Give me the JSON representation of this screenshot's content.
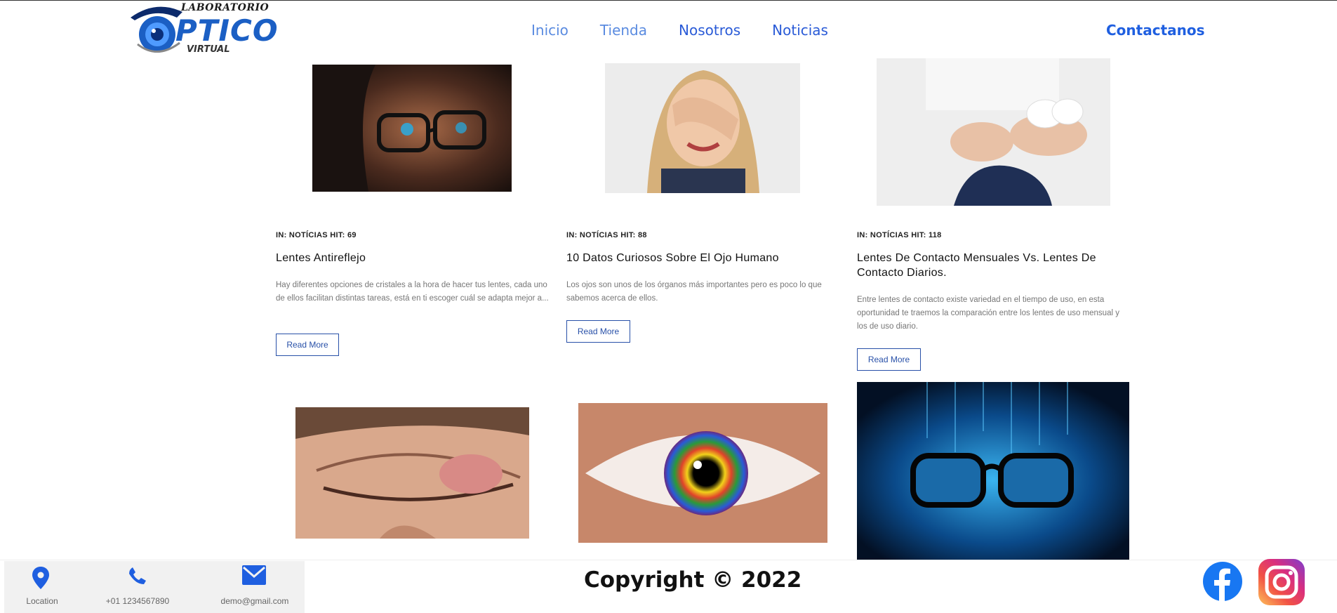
{
  "header": {
    "logo_top": "LABORATORIO",
    "logo_main": "PTICO",
    "logo_sub": "VIRTUAL",
    "nav": [
      "Inicio",
      "Tienda",
      "Nosotros",
      "Noticias"
    ],
    "contact": "Contactanos"
  },
  "articles": [
    {
      "meta": "IN: NOTÍCIAS HIT: 69",
      "title": "Lentes Antireflejo",
      "desc": "Hay diferentes opciones de cristales a la hora de hacer tus lentes, cada uno de ellos facilitan distintas tareas, está en ti escoger cuál se adapta mejor a...",
      "button": "Read More"
    },
    {
      "meta": "IN: NOTÍCIAS HIT: 88",
      "title": "10 Datos Curiosos Sobre El Ojo Humano",
      "desc": "Los ojos son unos de los órganos más importantes pero es poco lo que sabemos acerca de ellos.",
      "button": "Read More"
    },
    {
      "meta": "IN: NOTÍCIAS HIT: 118",
      "title": "Lentes De Contacto Mensuales Vs. Lentes De Contacto Diarios.",
      "desc": "Entre lentes de contacto existe variedad en el tiempo de uso, en esta oportunidad te traemos la comparación entre los lentes de uso mensual y los de uso diario.",
      "button": "Read More"
    }
  ],
  "footer": {
    "location": "Location",
    "phone": "+01 1234567890",
    "email": "demo@gmail.com",
    "copyright": "Copyright © 2022"
  },
  "colors": {
    "brand_blue": "#1b5fc4",
    "nav_blue": "#2a5bd7",
    "button_border": "#2850a8"
  }
}
